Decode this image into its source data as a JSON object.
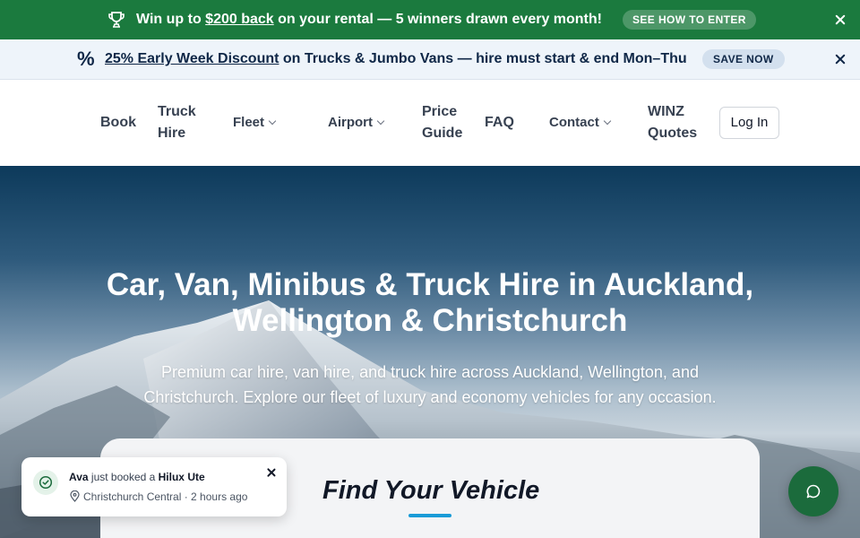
{
  "promo_top": {
    "prefix": "Win up to ",
    "highlight": "$200 back",
    "suffix": " on your rental — 5 winners drawn every month!",
    "cta": "SEE HOW TO ENTER",
    "bg_color": "#1b7a3e"
  },
  "promo_second": {
    "icon": "%",
    "highlight": "25% Early Week Discount",
    "suffix": " on Trucks & Jumbo Vans — hire must start & end Mon–Thu",
    "cta": "SAVE NOW"
  },
  "nav": {
    "book": "Book",
    "truck_hire_1": "Truck",
    "truck_hire_2": "Hire",
    "fleet": "Fleet",
    "airport": "Airport",
    "price_guide_1": "Price",
    "price_guide_2": "Guide",
    "faq": "FAQ",
    "contact": "Contact",
    "winz_1": "WINZ",
    "winz_2": "Quotes",
    "login": "Log In"
  },
  "hero": {
    "title_line1": "Car, Van, Minibus & Truck Hire in Auckland,",
    "title_line2": "Wellington & Christchurch",
    "subtitle": "Premium car hire, van hire, and truck hire across Auckland, Wellington, and Christchurch. Explore our fleet of luxury and economy vehicles for any occasion."
  },
  "search_card": {
    "title": "Find Your Vehicle",
    "accent_color": "#1a9bd7"
  },
  "toast": {
    "name": "Ava",
    "middle": " just booked a ",
    "vehicle": "Hilux Ute",
    "location": "Christchurch Central",
    "separator": " · ",
    "time": "2 hours ago"
  },
  "chat": {
    "icon": "chat-bubble-icon",
    "color": "#1b6b3c"
  }
}
